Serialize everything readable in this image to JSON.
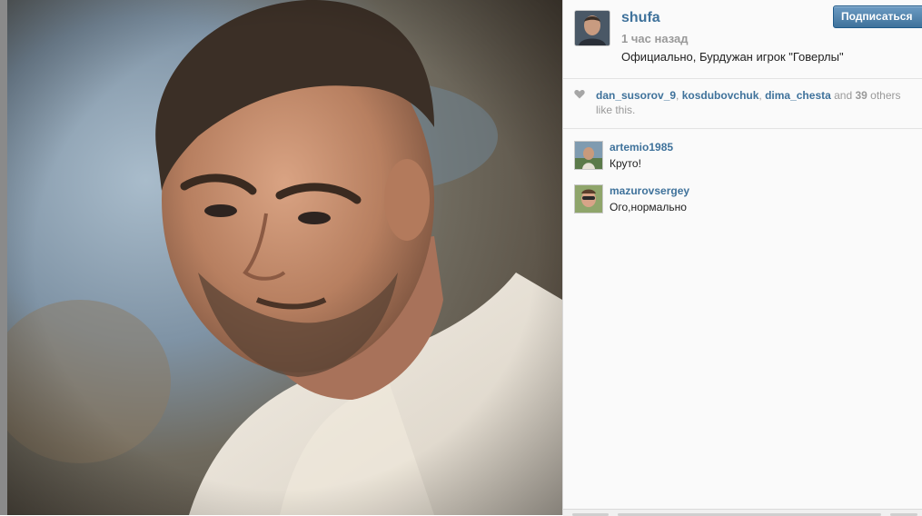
{
  "post": {
    "author": "shufa",
    "time": "1 час назад",
    "caption": "Официально, Бурдужан игрок \"Говерлы\"",
    "follow_label": "Подписаться"
  },
  "likes": {
    "users": [
      "dan_susorov_9",
      "kosdubovchuk",
      "dima_chesta"
    ],
    "separator": ", ",
    "and_word": " and ",
    "count": "39",
    "others_text": " others like this."
  },
  "comments": [
    {
      "user": "artemio1985",
      "text": "Круто!"
    },
    {
      "user": "mazurovsergey",
      "text": "Ого,нормально"
    }
  ],
  "colors": {
    "link": "#3f729b",
    "muted": "#999999",
    "button": "#3f729b"
  },
  "icons": {
    "like": "heart-icon"
  }
}
